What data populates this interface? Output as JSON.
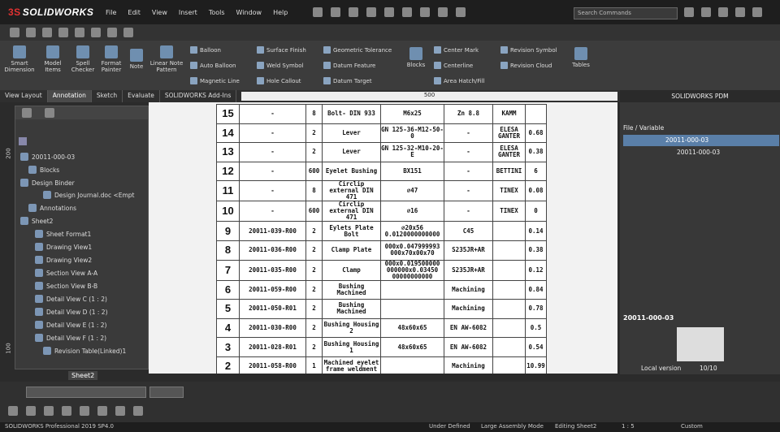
{
  "app": {
    "logo": "SOLIDWORKS",
    "menu": [
      "File",
      "Edit",
      "View",
      "Insert",
      "Tools",
      "Window",
      "Help"
    ],
    "search_placeholder": "Search Commands"
  },
  "ribbon": {
    "big": [
      "Smart Dimension",
      "Model Items",
      "Spell Checker",
      "Format Painter",
      "Note",
      "Linear Note Pattern",
      "Blocks",
      "Tables"
    ],
    "small": [
      "Balloon",
      "Auto Balloon",
      "Magnetic Line",
      "Surface Finish",
      "Weld Symbol",
      "Hole Callout",
      "Geometric Tolerance",
      "Datum Feature",
      "Datum Target",
      "Center Mark",
      "Centerline",
      "Area Hatch/Fill",
      "Revision Symbol",
      "Revision Cloud"
    ]
  },
  "tabs": [
    "View Layout",
    "Annotation",
    "Sketch",
    "Evaluate",
    "SOLIDWORKS Add-Ins"
  ],
  "ruler": {
    "mark": "500"
  },
  "tree": {
    "root": "20011-000-03",
    "items": [
      "Blocks",
      "Design Binder",
      "Design Journal.doc <Empt",
      "Annotations",
      "Sheet2",
      "Sheet Format1",
      "Drawing View1",
      "Drawing View2",
      "Section View A-A",
      "Section View B-B",
      "Detail View C (1 : 2)",
      "Detail View D (1 : 2)",
      "Detail View E (1 : 2)",
      "Detail View F (1 : 2)",
      "Revision Table(Linked)1"
    ],
    "sheet_tab": "Sheet2",
    "ruler_left": [
      "200",
      "100"
    ]
  },
  "bom": [
    [
      "15",
      "-",
      "8",
      "Bolt- DIN 933",
      "M6x25",
      "Zn 8.8",
      "KAMM",
      ""
    ],
    [
      "14",
      "-",
      "2",
      "Lever",
      "GN 125-36-M12-50-0",
      "-",
      "ELESA GANTER",
      "0.68"
    ],
    [
      "13",
      "-",
      "2",
      "Lever",
      "GN 125-32-M10-20-E",
      "-",
      "ELESA GANTER",
      "0.38"
    ],
    [
      "12",
      "-",
      "600",
      "Eyelet Bushing",
      "BX151",
      "-",
      "BETTINI",
      "6"
    ],
    [
      "11",
      "-",
      "8",
      "Circlip external DIN 471",
      "∅47",
      "-",
      "TINEX",
      "0.08"
    ],
    [
      "10",
      "-",
      "600",
      "Circlip external DIN 471",
      "∅16",
      "-",
      "TINEX",
      "0"
    ],
    [
      "9",
      "20011-039-R00",
      "2",
      "Eylets Plate Bolt",
      "∅20x56 0.0120000000000",
      "C45",
      "",
      "0.14"
    ],
    [
      "8",
      "20011-036-R00",
      "2",
      "Clamp Plate",
      "000x0.047999993 000x70x00x70",
      "S235JR+AR",
      "",
      "0.38"
    ],
    [
      "7",
      "20011-035-R00",
      "2",
      "Clamp",
      "000x0.019500000 000000x0.03450 00000000000",
      "S235JR+AR",
      "",
      "0.12"
    ],
    [
      "6",
      "20011-059-R00",
      "2",
      "Bushing Machined",
      "",
      "Machining",
      "",
      "0.84"
    ],
    [
      "5",
      "20011-050-R01",
      "2",
      "Bushing Machined",
      "",
      "Machining",
      "",
      "0.78"
    ],
    [
      "4",
      "20011-030-R00",
      "2",
      "Bushing Housing 2",
      "48x60x65",
      "EN AW-6082",
      "",
      "0.5"
    ],
    [
      "3",
      "20011-028-R01",
      "2",
      "Bushing Housing 1",
      "48x60x65",
      "EN AW-6082",
      "",
      "0.54"
    ],
    [
      "2",
      "20011-058-R00",
      "1",
      "Machined eyelet frame weldment",
      "",
      "Machining",
      "",
      "10.99"
    ]
  ],
  "pdm": {
    "title": "SOLIDWORKS PDM",
    "header": "File / Variable",
    "items": [
      "20011-000-03",
      "20011-000-03"
    ],
    "preview_title": "20011-000-03",
    "local_version_label": "Local version",
    "local_version_value": "10/10"
  },
  "status": {
    "app": "SOLIDWORKS Professional 2019 SP4.0",
    "state": "Under Defined",
    "mode": "Large Assembly Mode",
    "editing": "Editing Sheet2",
    "scale": "1 : 5",
    "units": "Custom"
  }
}
